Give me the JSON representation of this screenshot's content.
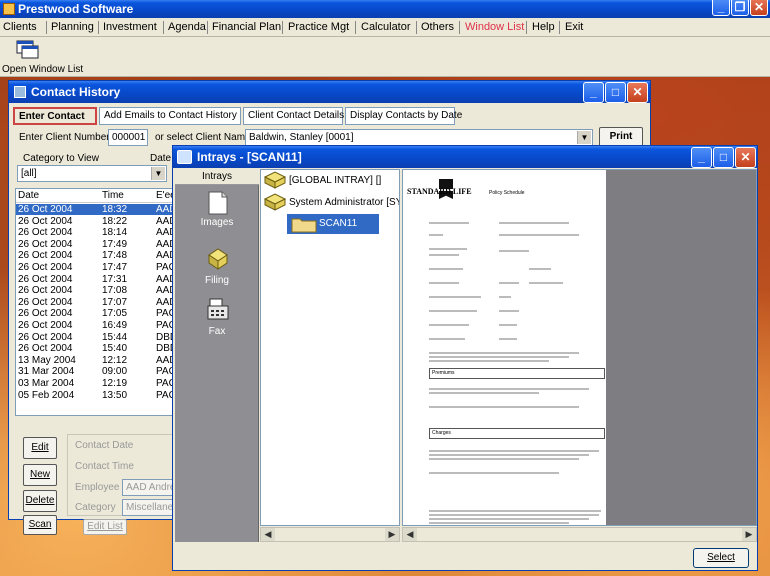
{
  "app": {
    "title": "Prestwood Software",
    "menu": [
      "Clients",
      "Planning",
      "Investment",
      "Agenda",
      "Financial Plan",
      "Practice Mgt",
      "Calculator",
      "Others",
      "Window List",
      "Help",
      "Exit"
    ],
    "toolbar_label": "Open Window List"
  },
  "contact_history": {
    "title": "Contact History",
    "tabs": [
      "Enter Contact",
      "Add Emails to Contact History",
      "Client Contact Details",
      "Display Contacts by Date"
    ],
    "client_number_label": "Enter Client Number",
    "client_number": "000001",
    "client_name_label": "or select Client Name",
    "client_name": "Baldwin, Stanley [0001]",
    "print_label": "Print",
    "category_label": "Category to View",
    "category_value": "[all]",
    "date_label": "Date",
    "columns": [
      "Date",
      "Time",
      "E'ee"
    ],
    "rows": [
      [
        "26 Oct 2004",
        "18:32",
        "AAD"
      ],
      [
        "26 Oct 2004",
        "18:22",
        "AAD"
      ],
      [
        "26 Oct 2004",
        "18:14",
        "AAD"
      ],
      [
        "26 Oct 2004",
        "17:49",
        "AAD"
      ],
      [
        "26 Oct 2004",
        "17:48",
        "AAD"
      ],
      [
        "26 Oct 2004",
        "17:47",
        "PAC"
      ],
      [
        "26 Oct 2004",
        "17:31",
        "AAD"
      ],
      [
        "26 Oct 2004",
        "17:08",
        "AAD"
      ],
      [
        "26 Oct 2004",
        "17:07",
        "AAD"
      ],
      [
        "26 Oct 2004",
        "17:05",
        "PAC"
      ],
      [
        "26 Oct 2004",
        "16:49",
        "PAC"
      ],
      [
        "26 Oct 2004",
        "15:44",
        "DBD"
      ],
      [
        "26 Oct 2004",
        "15:40",
        "DBD"
      ],
      [
        "13 May 2004",
        "12:12",
        "AAD"
      ],
      [
        "31 Mar 2004",
        "09:00",
        "PAC"
      ],
      [
        "03 Mar 2004",
        "12:19",
        "PAC"
      ],
      [
        "05 Feb 2004",
        "13:50",
        "PAC"
      ]
    ],
    "buttons": {
      "edit": "Edit",
      "new": "New",
      "delete": "Delete",
      "scan": "Scan",
      "edit_list": "Edit List"
    },
    "detail_labels": {
      "contact_date": "Contact Date",
      "contact_time": "Contact Time",
      "employee": "Employee",
      "category": "Category"
    },
    "employee_value": "AAD Andrew",
    "category_value2": "Miscellaneous"
  },
  "intrays": {
    "title": "Intrays - [SCAN11]",
    "sidebar_header": "Intrays",
    "sidebar": [
      "Images",
      "Filing",
      "Fax"
    ],
    "tree": [
      "[GLOBAL INTRAY] []",
      "System Administrator [SYSAD",
      "SCAN11"
    ],
    "select_label": "Select",
    "document": {
      "brand": "STANDARD LIFE",
      "subtitle": "Policy Schedule",
      "sections": [
        "Premiums",
        "Charges"
      ]
    }
  },
  "colors": {
    "titlebar": "#0a56de",
    "selection": "#316ac5",
    "window_bg": "#ece9d8"
  }
}
